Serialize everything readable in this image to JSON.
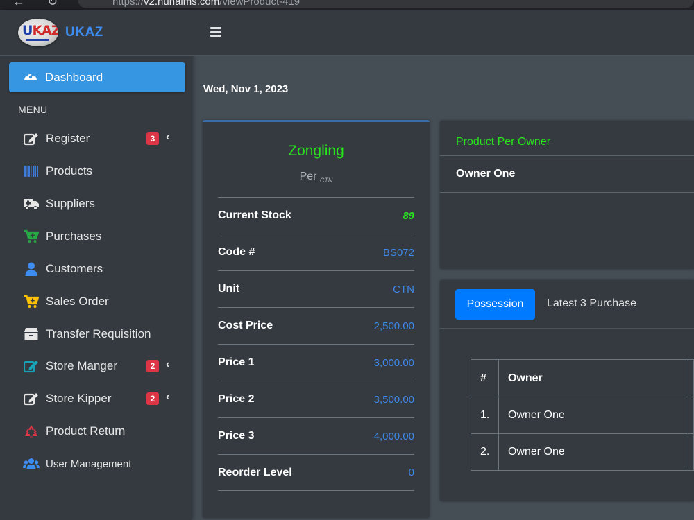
{
  "browser": {
    "url_prefix": "https://",
    "url_host": "v2.nuhaims.com",
    "url_path": "/viewProduct-419"
  },
  "brand": {
    "logo_text_a": "U",
    "logo_text_b": "KAZ",
    "name": "UKAZ"
  },
  "sidebar": {
    "active_item": {
      "label": "Dashboard",
      "icon": "tachometer-icon"
    },
    "menu_header": "MENU",
    "items": [
      {
        "label": "Register",
        "icon": "edit-icon",
        "badge": "3",
        "has_caret": true
      },
      {
        "label": "Products",
        "icon": "barcode-icon"
      },
      {
        "label": "Suppliers",
        "icon": "ambulance-icon"
      },
      {
        "label": "Purchases",
        "icon": "cart-plus-icon",
        "color": "#28a745"
      },
      {
        "label": "Customers",
        "icon": "user-icon",
        "color": "#3d8cf1"
      },
      {
        "label": "Sales Order",
        "icon": "cart-icon",
        "color": "#ffc107"
      },
      {
        "label": "Transfer Requisition",
        "icon": "box-icon"
      },
      {
        "label": "Store Manger",
        "icon": "edit-icon",
        "color": "#17a2b8",
        "badge": "2",
        "has_caret": true
      },
      {
        "label": "Store Kipper",
        "icon": "edit-icon",
        "badge": "2",
        "has_caret": true
      },
      {
        "label": "Product Return",
        "icon": "recycle-icon",
        "color": "#dc3545"
      },
      {
        "label": "User Management",
        "icon": "users-icon",
        "color": "#3d8cf1"
      }
    ],
    "caret": "‹"
  },
  "header": {
    "menu_icon": "bars-icon"
  },
  "date": "Wed, Nov 1, 2023",
  "product": {
    "name": "Zongling",
    "per_label": "Per",
    "per_unit": "CTN",
    "details": [
      {
        "key": "Current Stock",
        "value": "89"
      },
      {
        "key": "Code #",
        "value": "BS072"
      },
      {
        "key": "Unit",
        "value": "CTN"
      },
      {
        "key": "Cost Price",
        "value": "2,500.00"
      },
      {
        "key": "Price 1",
        "value": "3,000.00"
      },
      {
        "key": "Price 2",
        "value": "3,500.00"
      },
      {
        "key": "Price 3",
        "value": "4,000.00"
      },
      {
        "key": "Reorder Level",
        "value": "0"
      }
    ]
  },
  "owner_card": {
    "title": "Product Per Owner",
    "owner": "Owner One"
  },
  "tabs": {
    "active": "Possession",
    "inactive": "Latest 3 Purchase"
  },
  "table": {
    "headers": [
      "#",
      "Owner"
    ],
    "rows": [
      {
        "num": "1.",
        "owner": "Owner One"
      },
      {
        "num": "2.",
        "owner": "Owner One"
      }
    ]
  },
  "colors": {
    "accent": "#3796e2",
    "success": "#28e41c",
    "link": "#3f88e8",
    "badge": "#dc3545"
  }
}
